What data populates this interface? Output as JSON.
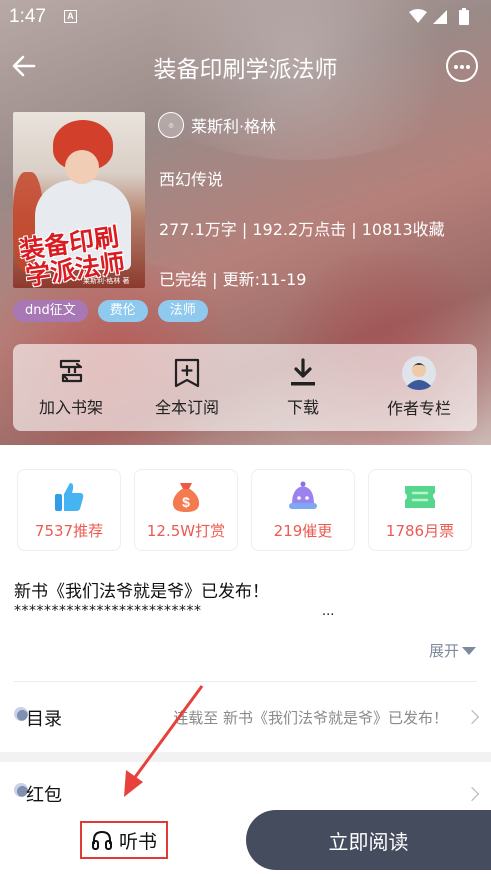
{
  "status_bar": {
    "time": "1:47",
    "a_icon": "A"
  },
  "nav": {
    "title": "装备印刷学派法师",
    "back_icon": "arrow-left-icon",
    "more_icon": "more-horizontal-icon"
  },
  "book": {
    "cover_title_line1": "装备印刷",
    "cover_title_line2": "学派法师",
    "cover_author": "莱斯利·格林 著",
    "author": "莱斯利·格林",
    "genre": "西幻传说",
    "stats_line": "277.1万字 | 192.2万点击 | 10813收藏",
    "status_line": "已完结 | 更新:11-19"
  },
  "tags": [
    {
      "label": "dnd征文",
      "color": "#a878b5"
    },
    {
      "label": "费伦",
      "color": "#8fc9ee"
    },
    {
      "label": "法师",
      "color": "#8fc9ee"
    }
  ],
  "actions": [
    {
      "label": "加入书架",
      "icon": "bookshelf-icon"
    },
    {
      "label": "全本订阅",
      "icon": "subscribe-icon"
    },
    {
      "label": "下载",
      "icon": "download-icon"
    },
    {
      "label": "作者专栏",
      "icon": "author-avatar-icon"
    }
  ],
  "stats": [
    {
      "value": "7537推荐",
      "icon": "thumbs-up-icon",
      "color": "#2f9ee8"
    },
    {
      "value": "12.5W打赏",
      "icon": "money-bag-icon",
      "color": "#ef5a43"
    },
    {
      "value": "219催更",
      "icon": "bell-icon",
      "color": "#8a6de8"
    },
    {
      "value": "1786月票",
      "icon": "ticket-icon",
      "color": "#4ad07f"
    }
  ],
  "notice": {
    "title": "新书《我们法爷就是爷》已发布！",
    "stars": "*************************",
    "ellipsis": "...",
    "expand": "展开"
  },
  "catalog": {
    "label": "目录",
    "subtitle": "连载至 新书《我们法爷就是爷》已发布！"
  },
  "red_packet": {
    "label": "红包"
  },
  "bottom": {
    "listen": "听书",
    "read": "立即阅读"
  },
  "colors": {
    "accent_red": "#e03b36",
    "read_button": "#454c5e",
    "stat_text": "#ec5b52"
  }
}
